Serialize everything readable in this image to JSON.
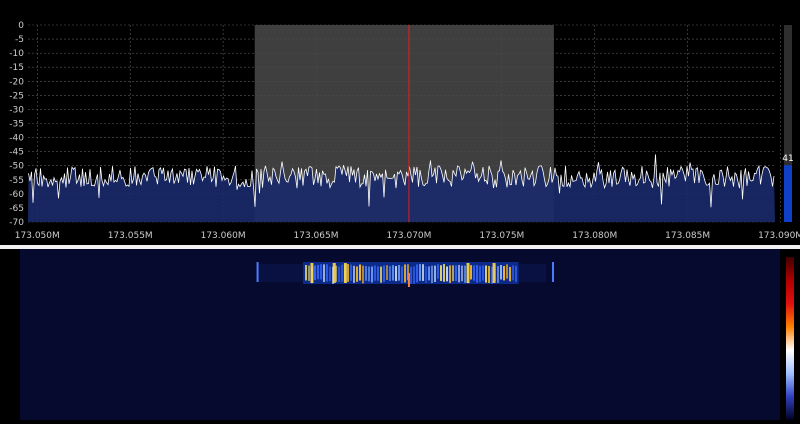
{
  "spectrum": {
    "y_ticks": [
      "0",
      "-5",
      "-10",
      "-15",
      "-20",
      "-25",
      "-30",
      "-35",
      "-40",
      "-45",
      "-50",
      "-55",
      "-60",
      "-65",
      "-70"
    ],
    "x_ticks": [
      "173.050M",
      "173.055M",
      "173.060M",
      "173.065M",
      "173.070M",
      "173.075M",
      "173.080M",
      "173.085M",
      "173.090M"
    ],
    "level_value": "41",
    "level_fraction": 0.41,
    "center_frequency_mhz": 173.07,
    "filter_band_mhz": [
      173.0617,
      173.0778
    ],
    "y_range_db": [
      -70,
      0
    ],
    "noise_floor_db": -54,
    "colors": {
      "background": "#000000",
      "grid": "#5a5a5a",
      "filter_band": "#4a4a4a",
      "trace": "#ffffff",
      "trace_fill": "#1a2a6a",
      "center_line": "#e02020",
      "level_bar": "#1040c8",
      "label": "#cccccc"
    }
  },
  "waterfall": {
    "background": "#050a2e",
    "signal_band_mhz": [
      173.0643,
      173.0759
    ],
    "gradient_colors": [
      "#400000",
      "#b00000",
      "#e01010",
      "#ff8000",
      "#ffffff",
      "#a0c0ff",
      "#3040c0",
      "#000020"
    ]
  }
}
